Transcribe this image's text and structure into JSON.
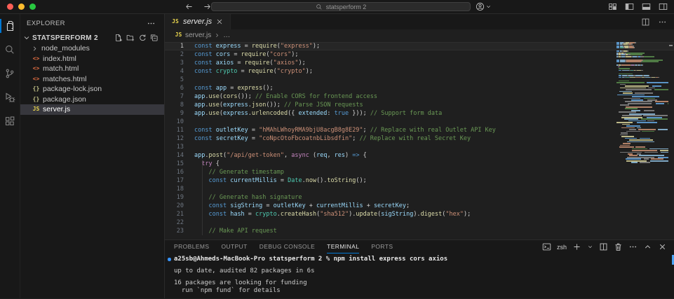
{
  "titlebar": {
    "search_text": "statsperform 2",
    "layout_icons": [
      "customize-layout-icon",
      "toggle-sidebar-icon",
      "toggle-panel-icon",
      "toggle-secondary-sidebar-icon"
    ]
  },
  "activity_bar": {
    "items": [
      {
        "name": "explorer",
        "icon": "files-icon",
        "active": true
      },
      {
        "name": "search",
        "icon": "search-icon"
      },
      {
        "name": "source-control",
        "icon": "source-control-icon"
      },
      {
        "name": "run-debug",
        "icon": "debug-icon"
      },
      {
        "name": "extensions",
        "icon": "extensions-icon"
      }
    ]
  },
  "sidebar": {
    "title": "EXPLORER",
    "section": {
      "name": "STATSPERFORM 2",
      "actions": [
        "new-file-icon",
        "new-folder-icon",
        "refresh-icon",
        "collapse-all-icon"
      ]
    },
    "files": [
      {
        "name": "node_modules",
        "kind": "folder"
      },
      {
        "name": "index.html",
        "icon": "html-file-icon"
      },
      {
        "name": "match.html",
        "icon": "html-file-icon"
      },
      {
        "name": "matches.html",
        "icon": "html-file-icon"
      },
      {
        "name": "package-lock.json",
        "icon": "json-file-icon"
      },
      {
        "name": "package.json",
        "icon": "json-file-icon"
      },
      {
        "name": "server.js",
        "icon": "js-file-icon",
        "selected": true
      }
    ]
  },
  "editor": {
    "tab": {
      "label": "server.js",
      "icon": "js-file-icon"
    },
    "breadcrumb": {
      "file": "server.js",
      "tail": "…"
    },
    "code_lines": [
      {
        "n": 1,
        "active": true,
        "tokens": [
          [
            "kw",
            "const"
          ],
          [
            "pl",
            " "
          ],
          [
            "var",
            "express"
          ],
          [
            "pl",
            " = "
          ],
          [
            "fn",
            "require"
          ],
          [
            "pl",
            "("
          ],
          [
            "str",
            "\"express\""
          ],
          [
            "pl",
            ");"
          ]
        ]
      },
      {
        "n": 2,
        "tokens": [
          [
            "kw",
            "const"
          ],
          [
            "pl",
            " "
          ],
          [
            "var",
            "cors"
          ],
          [
            "pl",
            " = "
          ],
          [
            "fn",
            "require"
          ],
          [
            "pl",
            "("
          ],
          [
            "str",
            "\"cors\""
          ],
          [
            "pl",
            ");"
          ]
        ]
      },
      {
        "n": 3,
        "tokens": [
          [
            "kw",
            "const"
          ],
          [
            "pl",
            " "
          ],
          [
            "var",
            "axios"
          ],
          [
            "pl",
            " = "
          ],
          [
            "fn",
            "require"
          ],
          [
            "pl",
            "("
          ],
          [
            "str",
            "\"axios\""
          ],
          [
            "pl",
            ");"
          ]
        ]
      },
      {
        "n": 4,
        "tokens": [
          [
            "kw",
            "const"
          ],
          [
            "pl",
            " "
          ],
          [
            "cls",
            "crypto"
          ],
          [
            "pl",
            " = "
          ],
          [
            "fn",
            "require"
          ],
          [
            "pl",
            "("
          ],
          [
            "str",
            "\"crypto\""
          ],
          [
            "pl",
            ");"
          ]
        ]
      },
      {
        "n": 5,
        "tokens": []
      },
      {
        "n": 6,
        "tokens": [
          [
            "kw",
            "const"
          ],
          [
            "pl",
            " "
          ],
          [
            "var",
            "app"
          ],
          [
            "pl",
            " = "
          ],
          [
            "fn",
            "express"
          ],
          [
            "pl",
            "();"
          ]
        ]
      },
      {
        "n": 7,
        "tokens": [
          [
            "var",
            "app"
          ],
          [
            "pl",
            "."
          ],
          [
            "fn",
            "use"
          ],
          [
            "pl",
            "("
          ],
          [
            "fn",
            "cors"
          ],
          [
            "pl",
            "()); "
          ],
          [
            "cm",
            "// Enable CORS for frontend access"
          ]
        ]
      },
      {
        "n": 8,
        "tokens": [
          [
            "var",
            "app"
          ],
          [
            "pl",
            "."
          ],
          [
            "fn",
            "use"
          ],
          [
            "pl",
            "("
          ],
          [
            "var",
            "express"
          ],
          [
            "pl",
            "."
          ],
          [
            "fn",
            "json"
          ],
          [
            "pl",
            "()); "
          ],
          [
            "cm",
            "// Parse JSON requests"
          ]
        ]
      },
      {
        "n": 9,
        "tokens": [
          [
            "var",
            "app"
          ],
          [
            "pl",
            "."
          ],
          [
            "fn",
            "use"
          ],
          [
            "pl",
            "("
          ],
          [
            "var",
            "express"
          ],
          [
            "pl",
            "."
          ],
          [
            "fn",
            "urlencoded"
          ],
          [
            "pl",
            "({ "
          ],
          [
            "var",
            "extended"
          ],
          [
            "pl",
            ": "
          ],
          [
            "kw",
            "true"
          ],
          [
            "pl",
            " })); "
          ],
          [
            "cm",
            "// Support form data"
          ]
        ]
      },
      {
        "n": 10,
        "tokens": []
      },
      {
        "n": 11,
        "tokens": [
          [
            "kw",
            "const"
          ],
          [
            "pl",
            " "
          ],
          [
            "var",
            "outletKey"
          ],
          [
            "pl",
            " = "
          ],
          [
            "str",
            "\"hMAhLWhoyRMA9bjU8acgB8g8E29\""
          ],
          [
            "pl",
            "; "
          ],
          [
            "cm",
            "// Replace with real Outlet API Key"
          ]
        ]
      },
      {
        "n": 12,
        "tokens": [
          [
            "kw",
            "const"
          ],
          [
            "pl",
            " "
          ],
          [
            "var",
            "secretKey"
          ],
          [
            "pl",
            " = "
          ],
          [
            "str",
            "\"coNpcOtoFbcoatnbLibsdfin\""
          ],
          [
            "pl",
            "; "
          ],
          [
            "cm",
            "// Replace with real Secret Key"
          ]
        ]
      },
      {
        "n": 13,
        "tokens": []
      },
      {
        "n": 14,
        "tokens": [
          [
            "var",
            "app"
          ],
          [
            "pl",
            "."
          ],
          [
            "fn",
            "post"
          ],
          [
            "pl",
            "("
          ],
          [
            "str",
            "\"/api/get-token\""
          ],
          [
            "pl",
            ", "
          ],
          [
            "ctl",
            "async"
          ],
          [
            "pl",
            " ("
          ],
          [
            "var",
            "req"
          ],
          [
            "pl",
            ", "
          ],
          [
            "var",
            "res"
          ],
          [
            "pl",
            ") "
          ],
          [
            "kw",
            "=>"
          ],
          [
            "pl",
            " {"
          ]
        ]
      },
      {
        "n": 15,
        "tokens": [
          [
            "pl",
            "  "
          ],
          [
            "ctl",
            "try"
          ],
          [
            "pl",
            " {"
          ]
        ]
      },
      {
        "n": 16,
        "tokens": [
          [
            "pl",
            "    "
          ],
          [
            "cm",
            "// Generate timestamp"
          ]
        ]
      },
      {
        "n": 17,
        "tokens": [
          [
            "pl",
            "    "
          ],
          [
            "kw",
            "const"
          ],
          [
            "pl",
            " "
          ],
          [
            "var",
            "currentMillis"
          ],
          [
            "pl",
            " = "
          ],
          [
            "cls",
            "Date"
          ],
          [
            "pl",
            "."
          ],
          [
            "fn",
            "now"
          ],
          [
            "pl",
            "()."
          ],
          [
            "fn",
            "toString"
          ],
          [
            "pl",
            "();"
          ]
        ]
      },
      {
        "n": 18,
        "tokens": []
      },
      {
        "n": 19,
        "tokens": [
          [
            "pl",
            "    "
          ],
          [
            "cm",
            "// Generate hash signature"
          ]
        ]
      },
      {
        "n": 20,
        "tokens": [
          [
            "pl",
            "    "
          ],
          [
            "kw",
            "const"
          ],
          [
            "pl",
            " "
          ],
          [
            "var",
            "sigString"
          ],
          [
            "pl",
            " = "
          ],
          [
            "var",
            "outletKey"
          ],
          [
            "pl",
            " + "
          ],
          [
            "var",
            "currentMillis"
          ],
          [
            "pl",
            " + "
          ],
          [
            "var",
            "secretKey"
          ],
          [
            "pl",
            ";"
          ]
        ]
      },
      {
        "n": 21,
        "tokens": [
          [
            "pl",
            "    "
          ],
          [
            "kw",
            "const"
          ],
          [
            "pl",
            " "
          ],
          [
            "var",
            "hash"
          ],
          [
            "pl",
            " = "
          ],
          [
            "cls",
            "crypto"
          ],
          [
            "pl",
            "."
          ],
          [
            "fn",
            "createHash"
          ],
          [
            "pl",
            "("
          ],
          [
            "str",
            "\"sha512\""
          ],
          [
            "pl",
            ")."
          ],
          [
            "fn",
            "update"
          ],
          [
            "pl",
            "("
          ],
          [
            "var",
            "sigString"
          ],
          [
            "pl",
            ")."
          ],
          [
            "fn",
            "digest"
          ],
          [
            "pl",
            "("
          ],
          [
            "str",
            "\"hex\""
          ],
          [
            "pl",
            ");"
          ]
        ]
      },
      {
        "n": 22,
        "tokens": []
      },
      {
        "n": 23,
        "tokens": [
          [
            "pl",
            "    "
          ],
          [
            "cm",
            "// Make API request"
          ]
        ]
      }
    ]
  },
  "panel": {
    "tabs": [
      "PROBLEMS",
      "OUTPUT",
      "DEBUG CONSOLE",
      "TERMINAL",
      "PORTS"
    ],
    "active_tab": "TERMINAL",
    "shell": "zsh",
    "terminal_lines": [
      {
        "kind": "command",
        "text": "a25sb@Ahmeds-MacBook-Pro statsperform 2 % npm install express cors axios"
      },
      {
        "kind": "blank",
        "text": ""
      },
      {
        "kind": "output",
        "text": "up to date, audited 82 packages in 6s"
      },
      {
        "kind": "blank",
        "text": ""
      },
      {
        "kind": "output",
        "text": "16 packages are looking for funding"
      },
      {
        "kind": "output",
        "text": "  run `npm fund` for details"
      }
    ]
  },
  "colors": {
    "accent": "#0078d4",
    "titlebar_bg": "#181818",
    "editor_bg": "#1f1f1f",
    "sidebar_bg": "#181818",
    "selection_bg": "#37373d",
    "keyword": "#569cd6",
    "variable": "#9cdcfe",
    "function": "#dcdcaa",
    "string": "#ce9178",
    "comment": "#6a9955",
    "class": "#4ec9b0",
    "control": "#c586c0",
    "text": "#d4d4d4",
    "terminal_command_dot": "#3794ff",
    "traffic_red": "#ff5f57",
    "traffic_yellow": "#febc2e",
    "traffic_green": "#28c840"
  }
}
